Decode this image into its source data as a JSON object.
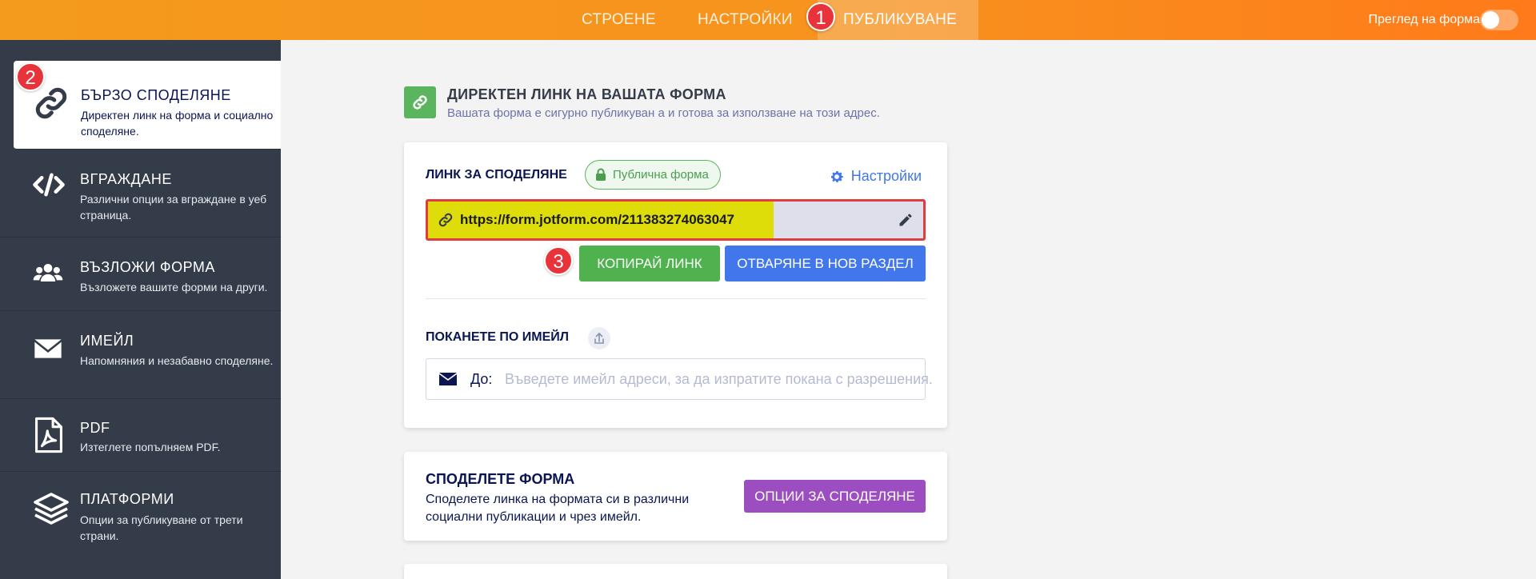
{
  "topbar": {
    "tabs": [
      {
        "label": "СТРОЕНЕ"
      },
      {
        "label": "НАСТРОЙКИ"
      },
      {
        "label": "ПУБЛИКУВАНЕ"
      }
    ],
    "preview_label": "Преглед на форма",
    "preview_enabled": false
  },
  "badges": {
    "one": "1",
    "two": "2",
    "three": "3"
  },
  "sidebar": {
    "items": [
      {
        "title": "БЪРЗО СПОДЕЛЯНЕ",
        "desc": "Директен линк на форма и социално споделяне.",
        "icon": "link-icon",
        "active": true
      },
      {
        "title": "ВГРАЖДАНЕ",
        "desc": "Различни опции за вграждане в уеб страница.",
        "icon": "code-icon"
      },
      {
        "title": "ВЪЗЛОЖИ ФОРМА",
        "desc": "Възложете вашите форми на други.",
        "icon": "users-icon"
      },
      {
        "title": "ИМЕЙЛ",
        "desc": "Напомняния и незабавно споделяне.",
        "icon": "envelope-icon"
      },
      {
        "title": "PDF",
        "desc": "Изтеглете попълняем PDF.",
        "icon": "pdf-icon"
      },
      {
        "title": "ПЛАТФОРМИ",
        "desc": "Опции за публикуване от трети страни.",
        "icon": "layers-icon"
      }
    ]
  },
  "main": {
    "header": {
      "title": "ДИРЕКТЕН ЛИНК НА ВАШАТА ФОРМА",
      "subtitle": "Вашата форма е сигурно публикуван а и готова за използване на този адрес."
    },
    "share_card": {
      "label": "ЛИНК ЗА СПОДЕЛЯНЕ",
      "pill": "Публична форма",
      "settings_link": "Настройки",
      "url": "https://form.jotform.com/211383274063047",
      "copy_button": "КОПИРАЙ ЛИНК",
      "open_button": "ОТВАРЯНЕ В НОВ РАЗДЕЛ",
      "invite_label": "ПОКАНЕТЕ ПО ИМЕЙЛ",
      "to_label": "До:",
      "email_placeholder": "Въведете имейл адреси, за да изпратите покана с разрешения."
    },
    "social_card": {
      "title": "СПОДЕЛЕТЕ ФОРМА",
      "desc": "Споделете линка на формата си в различни социални публикации и чрез имейл.",
      "button": "ОПЦИИ ЗА СПОДЕЛЯНЕ"
    }
  },
  "colors": {
    "topbar": "#f7931e",
    "sidebar": "#343c4a",
    "green": "#4fb24f",
    "blue": "#4277ec",
    "purple": "#9c4dbf",
    "highlight": "#dedd0a",
    "badge": "#e8333a"
  }
}
